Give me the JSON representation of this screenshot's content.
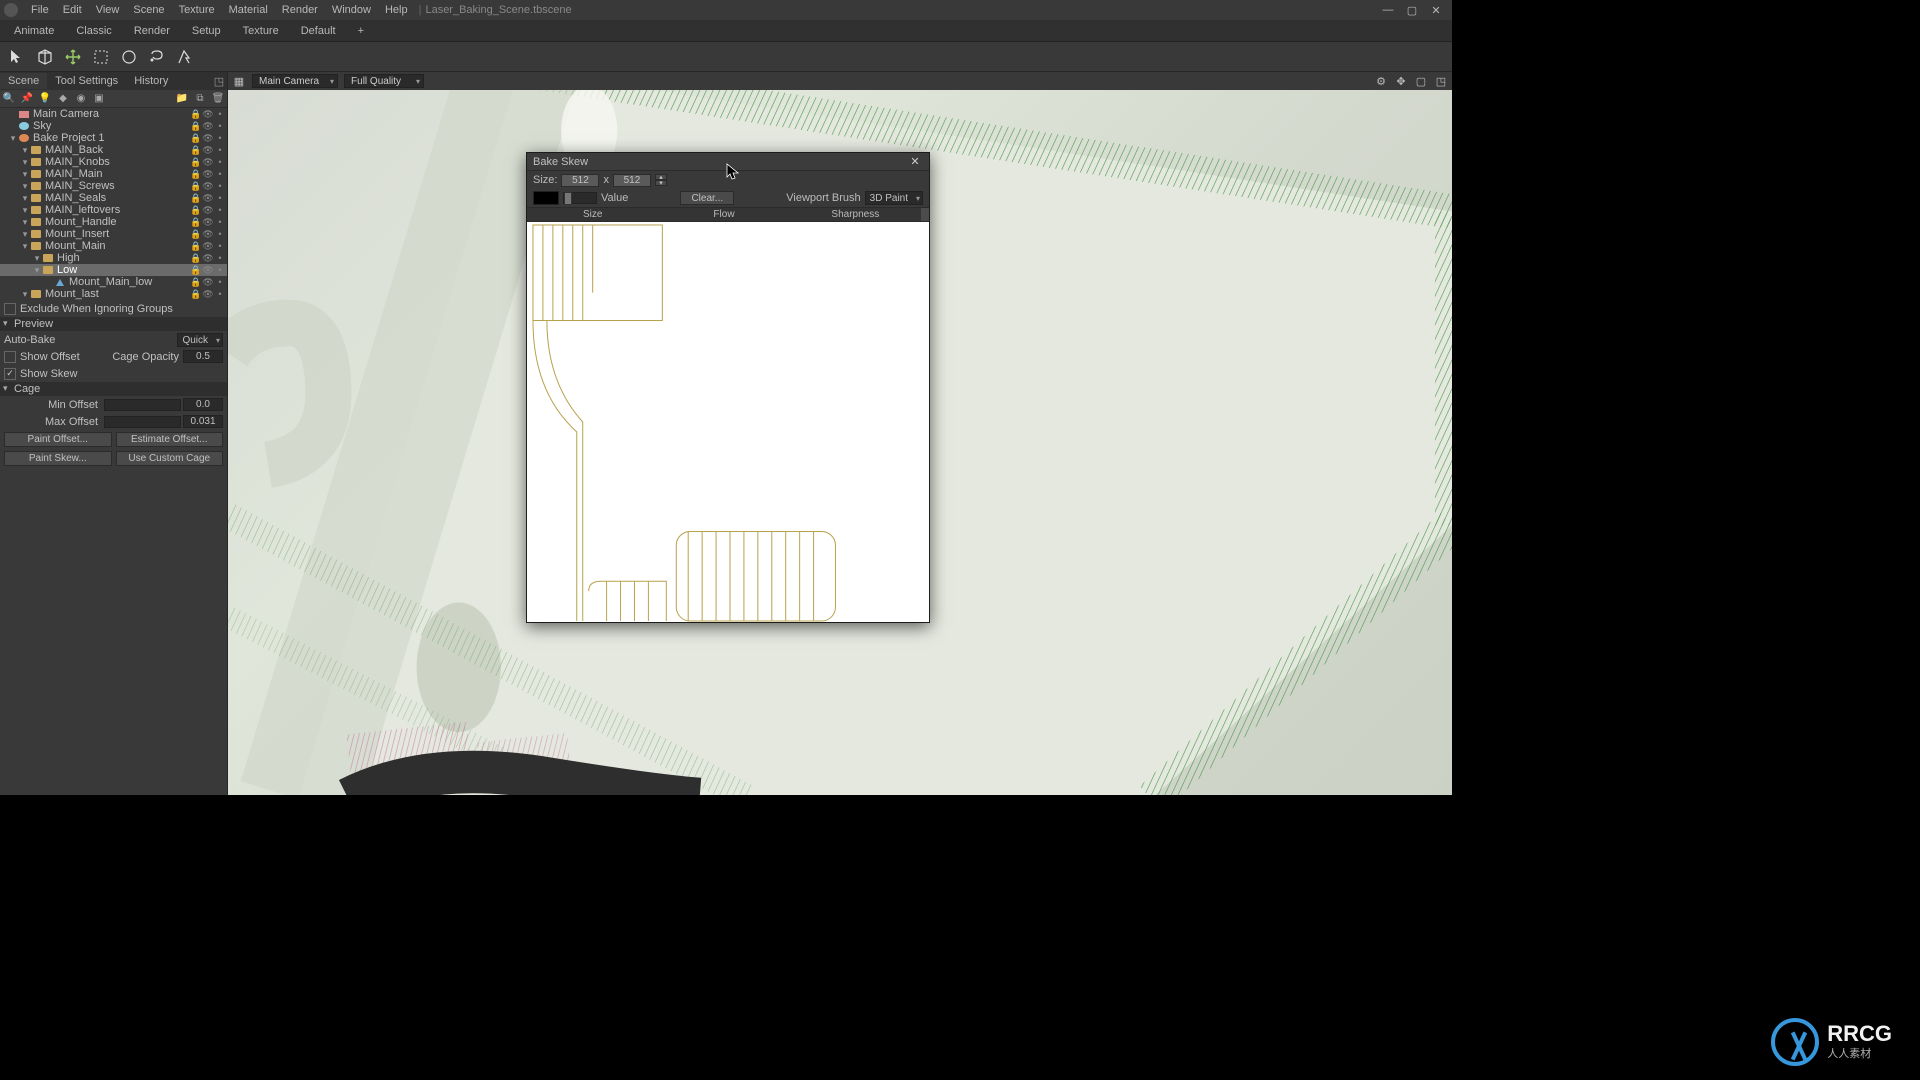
{
  "title_menu": {
    "file": "File",
    "edit": "Edit",
    "view": "View",
    "scene": "Scene",
    "texture": "Texture",
    "material": "Material",
    "render": "Render",
    "window": "Window",
    "help": "Help"
  },
  "doc_name": "Laser_Baking_Scene.tbscene",
  "modes": {
    "animate": "Animate",
    "classic": "Classic",
    "render": "Render",
    "setup": "Setup",
    "texture": "Texture",
    "default": "Default",
    "add": "+"
  },
  "left_tabs": {
    "scene": "Scene",
    "tool": "Tool Settings",
    "history": "History"
  },
  "viewport": {
    "camera": "Main Camera",
    "quality": "Full Quality"
  },
  "tree": [
    {
      "d": 0,
      "t": "cam",
      "l": "Main Camera"
    },
    {
      "d": 0,
      "t": "sky",
      "l": "Sky"
    },
    {
      "d": 0,
      "t": "bake",
      "l": "Bake Project 1"
    },
    {
      "d": 1,
      "t": "folder",
      "l": "MAIN_Back"
    },
    {
      "d": 1,
      "t": "folder",
      "l": "MAIN_Knobs"
    },
    {
      "d": 1,
      "t": "folder",
      "l": "MAIN_Main"
    },
    {
      "d": 1,
      "t": "folder",
      "l": "MAIN_Screws"
    },
    {
      "d": 1,
      "t": "folder",
      "l": "MAIN_Seals"
    },
    {
      "d": 1,
      "t": "folder",
      "l": "MAIN_leftovers"
    },
    {
      "d": 1,
      "t": "folder",
      "l": "Mount_Handle"
    },
    {
      "d": 1,
      "t": "folder",
      "l": "Mount_Insert"
    },
    {
      "d": 1,
      "t": "folder",
      "l": "Mount_Main"
    },
    {
      "d": 2,
      "t": "folder",
      "l": "High"
    },
    {
      "d": 2,
      "t": "folder",
      "l": "Low",
      "sel": true
    },
    {
      "d": 3,
      "t": "mesh",
      "l": "Mount_Main_low"
    },
    {
      "d": 1,
      "t": "folder",
      "l": "Mount_last"
    }
  ],
  "props": {
    "exclude": "Exclude When Ignoring Groups",
    "preview": "Preview",
    "autobake_lbl": "Auto-Bake",
    "autobake_val": "Quick",
    "showoffset_lbl": "Show Offset",
    "cageop_lbl": "Cage Opacity",
    "cageop_val": "0.5",
    "showskew_lbl": "Show Skew",
    "cage": "Cage",
    "minoff_lbl": "Min Offset",
    "minoff_val": "0.0",
    "maxoff_lbl": "Max Offset",
    "maxoff_val": "0.031",
    "paintoff": "Paint Offset...",
    "estoff": "Estimate Offset...",
    "paintskew": "Paint Skew...",
    "usecage": "Use Custom Cage"
  },
  "dialog": {
    "title": "Bake Skew",
    "size_lbl": "Size:",
    "size_w": "512",
    "size_x": "x",
    "size_h": "512",
    "value": "Value",
    "clear": "Clear...",
    "vpbrush": "Viewport Brush",
    "vpbrush_val": "3D Paint",
    "col_size": "Size",
    "col_flow": "Flow",
    "col_sharp": "Sharpness"
  },
  "watermark": {
    "brand": "RRCG",
    "sub": "人人素材"
  }
}
